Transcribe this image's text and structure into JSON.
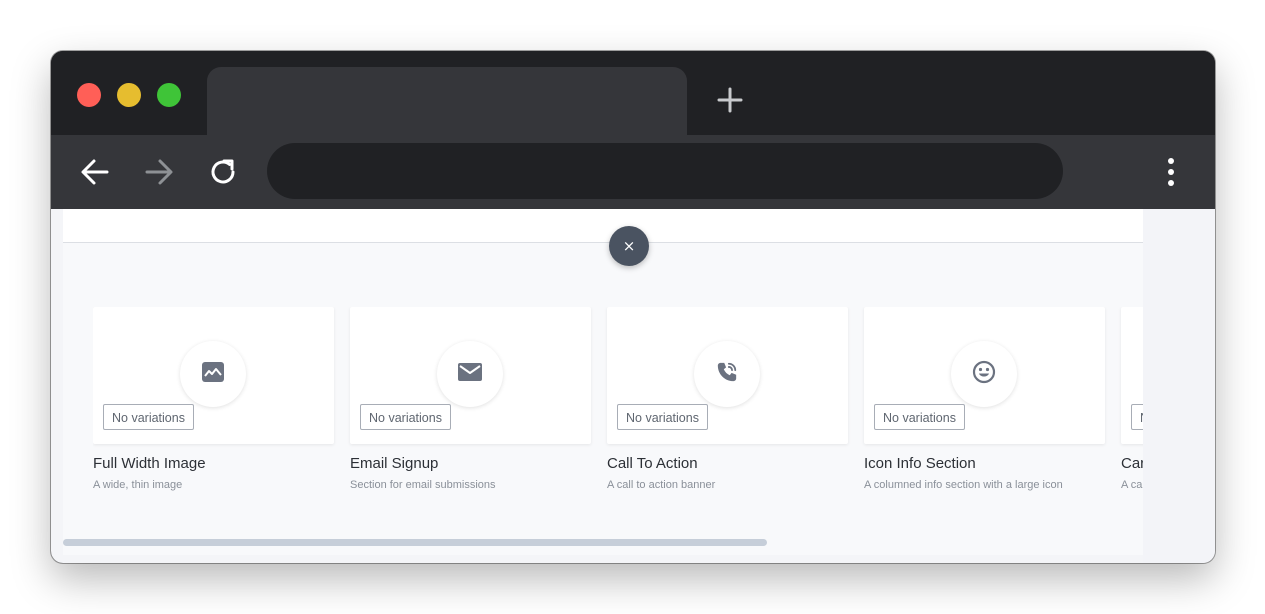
{
  "browser": {
    "address_bar": {
      "value": ""
    },
    "icons": {
      "back": "arrow-left-icon",
      "forward": "arrow-right-icon",
      "reload": "reload-icon",
      "new_tab": "plus-icon",
      "menu": "vertical-dots-icon"
    }
  },
  "page": {
    "close_label": "×",
    "blocks": [
      {
        "title": "Full Width Image",
        "description": "A wide, thin image",
        "badge": "No variations",
        "icon": "image-icon"
      },
      {
        "title": "Email Signup",
        "description": "Section for email submissions",
        "badge": "No variations",
        "icon": "envelope-icon"
      },
      {
        "title": "Call To Action",
        "description": "A call to action banner",
        "badge": "No variations",
        "icon": "phone-icon"
      },
      {
        "title": "Icon Info Section",
        "description": "A columned info section with a large icon",
        "badge": "No variations",
        "icon": "smiley-icon"
      },
      {
        "title": "Car",
        "description": "A ca",
        "badge": "No variations",
        "icon": ""
      }
    ]
  },
  "colors": {
    "chrome_dark": "#202124",
    "chrome_toolbar": "#35363a",
    "close_button": "#4a5361",
    "icon_gray": "#6b7280",
    "scrollbar": "#c6ced9"
  }
}
